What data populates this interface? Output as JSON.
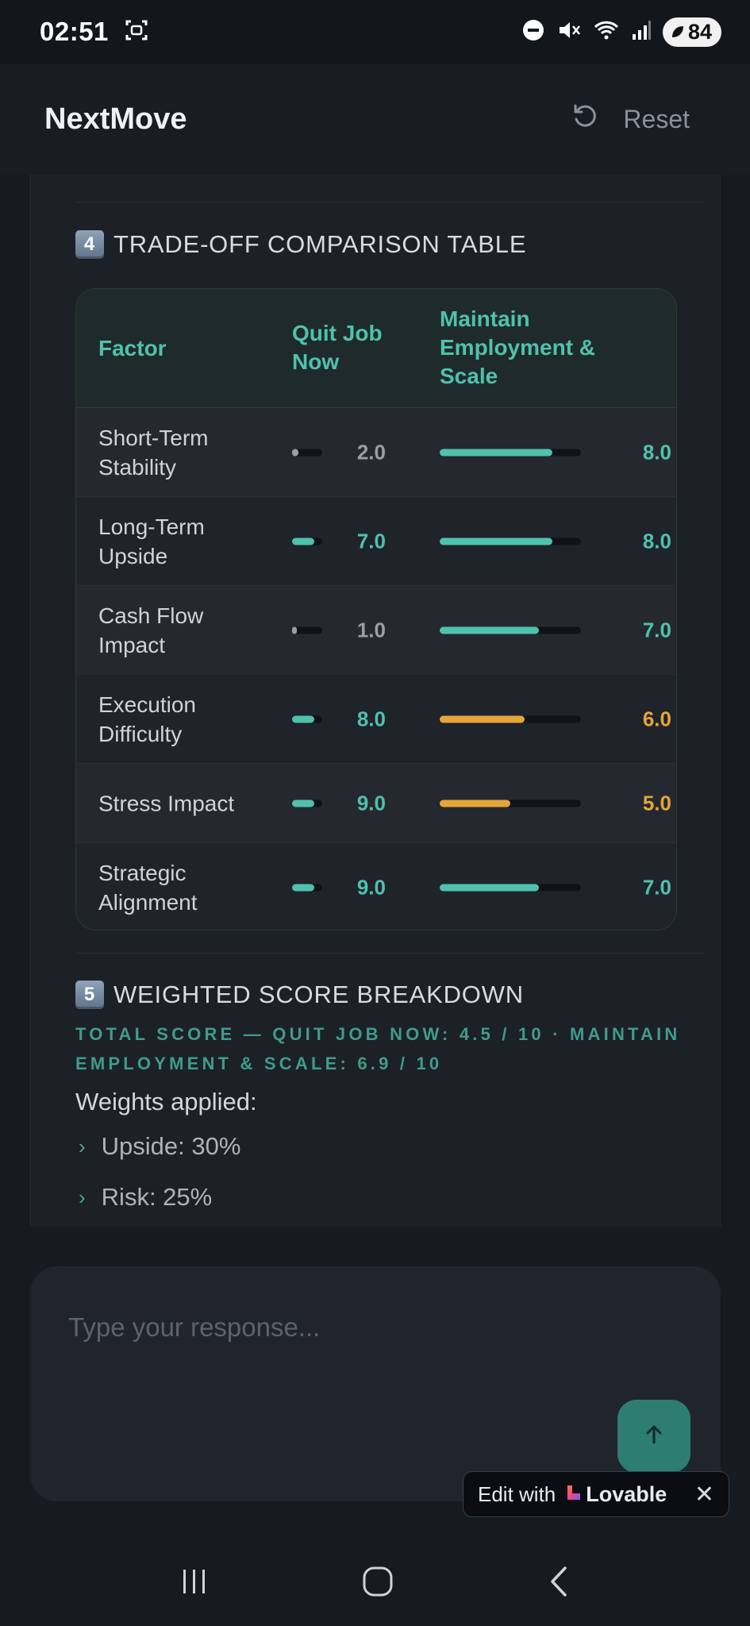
{
  "status_bar": {
    "time": "02:51",
    "battery": "84"
  },
  "header": {
    "title": "NextMove",
    "reset_label": "Reset"
  },
  "section4": {
    "number": "4",
    "title": "TRADE-OFF COMPARISON TABLE",
    "columns": {
      "factor": "Factor",
      "option_a": "Quit Job Now",
      "option_b": "Maintain Employment & Scale"
    },
    "rows": [
      {
        "factor": "Short-Term Stability",
        "a_score": "2.0",
        "a_value": 2.0,
        "b_score": "8.0",
        "b_value": 8.0
      },
      {
        "factor": "Long-Term Upside",
        "a_score": "7.0",
        "a_value": 7.0,
        "b_score": "8.0",
        "b_value": 8.0
      },
      {
        "factor": "Cash Flow Impact",
        "a_score": "1.0",
        "a_value": 1.0,
        "b_score": "7.0",
        "b_value": 7.0
      },
      {
        "factor": "Execution Difficulty",
        "a_score": "8.0",
        "a_value": 8.0,
        "b_score": "6.0",
        "b_value": 6.0
      },
      {
        "factor": "Stress Impact",
        "a_score": "9.0",
        "a_value": 9.0,
        "b_score": "5.0",
        "b_value": 5.0
      },
      {
        "factor": "Strategic Alignment",
        "a_score": "9.0",
        "a_value": 9.0,
        "b_score": "7.0",
        "b_value": 7.0
      }
    ]
  },
  "section5": {
    "number": "5",
    "title": "WEIGHTED SCORE BREAKDOWN",
    "total_line": "TOTAL SCORE — QUIT JOB NOW: 4.5 / 10 · MAINTAIN EMPLOYMENT & SCALE: 6.9 / 10",
    "weights_label": "Weights applied:",
    "weights": [
      "Upside: 30%",
      "Risk: 25%"
    ]
  },
  "composer": {
    "placeholder": "Type your response..."
  },
  "lovable_badge": {
    "prefix": "Edit with",
    "brand": "Lovable"
  },
  "colors": {
    "accent": "#4fc1ad",
    "warning": "#e6a53a",
    "muted": "#9aa0a8"
  }
}
